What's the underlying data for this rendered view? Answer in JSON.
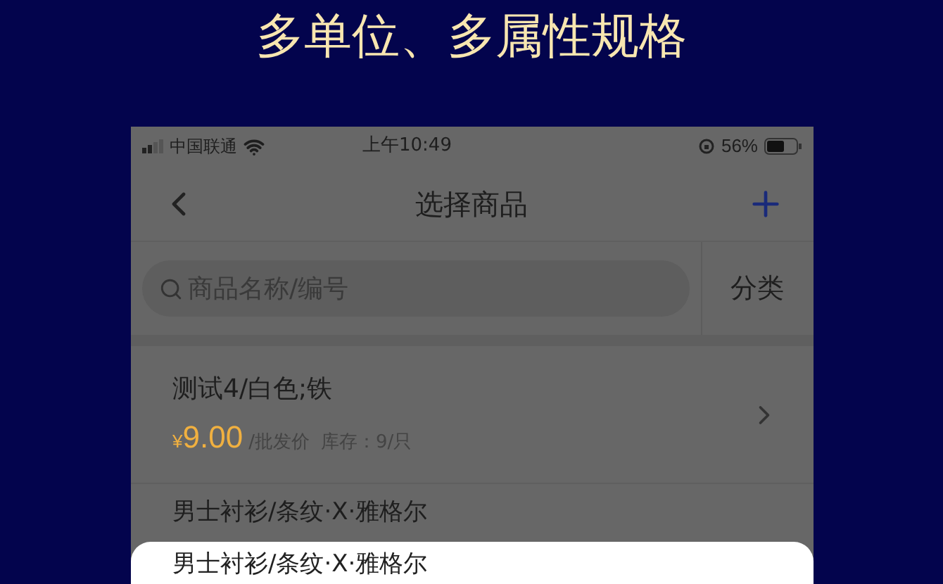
{
  "headline": "多单位、多属性规格",
  "status_bar": {
    "carrier": "中国联通",
    "time": "上午10:49",
    "battery": "56%"
  },
  "nav": {
    "title": "选择商品"
  },
  "search": {
    "placeholder": "商品名称/编号",
    "category_button": "分类"
  },
  "products": [
    {
      "name": "测试4/白色;铁",
      "currency": "¥",
      "price": "9.00",
      "price_type": "/批发价",
      "stock": "库存：9/只"
    },
    {
      "name": "男士衬衫/条纹·X·雅格尔"
    }
  ],
  "sheet": {
    "title": "男士衬衫/条纹·X·雅格尔"
  }
}
